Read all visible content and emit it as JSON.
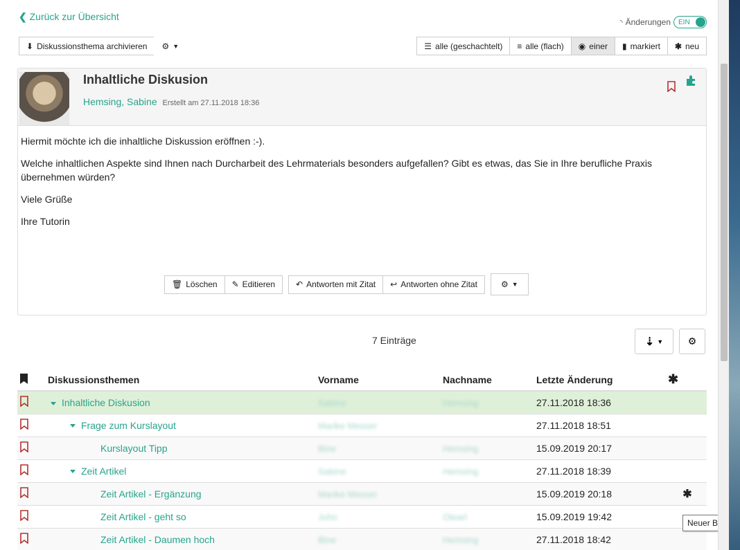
{
  "nav": {
    "back_label": "Zurück zur Übersicht"
  },
  "changes": {
    "label": "Änderungen",
    "toggle_label": "EIN"
  },
  "toolbar": {
    "archive_label": "Diskussionsthema archivieren"
  },
  "views": [
    {
      "label": "alle (geschachtelt)",
      "icon": "nested-list-icon"
    },
    {
      "label": "alle (flach)",
      "icon": "flat-list-icon"
    },
    {
      "label": "einer",
      "icon": "eye-icon",
      "active": true
    },
    {
      "label": "markiert",
      "icon": "bookmark-icon"
    },
    {
      "label": "neu",
      "icon": "asterisk-icon"
    }
  ],
  "post": {
    "title": "Inhaltliche Diskusion",
    "author": "Hemsing, Sabine",
    "created": "Erstellt am 27.11.2018 18:36",
    "paragraphs": [
      "Hiermit möchte ich die inhaltliche Diskussion eröffnen :-).",
      "Welche inhaltlichen Aspekte sind Ihnen nach Durcharbeit des Lehrmaterials besonders aufgefallen? Gibt es etwas, das Sie in Ihre berufliche Praxis übernehmen würden?",
      "Viele Grüße",
      "Ihre Tutorin"
    ],
    "actions": {
      "delete": "Löschen",
      "edit": "Editieren",
      "reply_quote": "Antworten mit Zitat",
      "reply": "Antworten ohne Zitat"
    }
  },
  "list": {
    "count": "7 Einträge",
    "headers": {
      "title": "Diskussionsthemen",
      "firstname": "Vorname",
      "lastname": "Nachname",
      "changed": "Letzte Änderung",
      "new": "✱"
    },
    "rows": [
      {
        "title": "Inhaltliche Diskusion",
        "level": 0,
        "expanded": true,
        "firstname": "Sabine",
        "lastname": "Hemsing",
        "changed": "27.11.2018 18:36",
        "new": "",
        "selected": true
      },
      {
        "title": "Frage zum Kurslayout",
        "level": 1,
        "expanded": true,
        "firstname": "Marike Messer",
        "lastname": "",
        "changed": "27.11.2018 18:51",
        "new": ""
      },
      {
        "title": "Kurslayout Tipp",
        "level": 2,
        "expanded": false,
        "firstname": "Bine",
        "lastname": "Hemsing",
        "changed": "15.09.2019 20:17",
        "new": ""
      },
      {
        "title": "Zeit Artikel",
        "level": 1,
        "expanded": true,
        "firstname": "Sabine",
        "lastname": "Hemsing",
        "changed": "27.11.2018 18:39",
        "new": ""
      },
      {
        "title": "Zeit Artikel - Ergänzung",
        "level": 2,
        "expanded": false,
        "firstname": "Marike Messer",
        "lastname": "",
        "changed": "15.09.2019 20:18",
        "new": "✱"
      },
      {
        "title": "Zeit Artikel - geht so",
        "level": 2,
        "expanded": false,
        "firstname": "John",
        "lastname": "Olearl",
        "changed": "15.09.2019 19:42",
        "new": ""
      },
      {
        "title": "Zeit Artikel - Daumen hoch",
        "level": 2,
        "expanded": false,
        "firstname": "Bine",
        "lastname": "Hemsing",
        "changed": "27.11.2018 18:42",
        "new": ""
      }
    ]
  },
  "tooltip": "Neuer Beitrag",
  "colors": {
    "accent": "#27a38c",
    "bookmark": "#b5302f",
    "selected_row": "#dff0d8"
  }
}
